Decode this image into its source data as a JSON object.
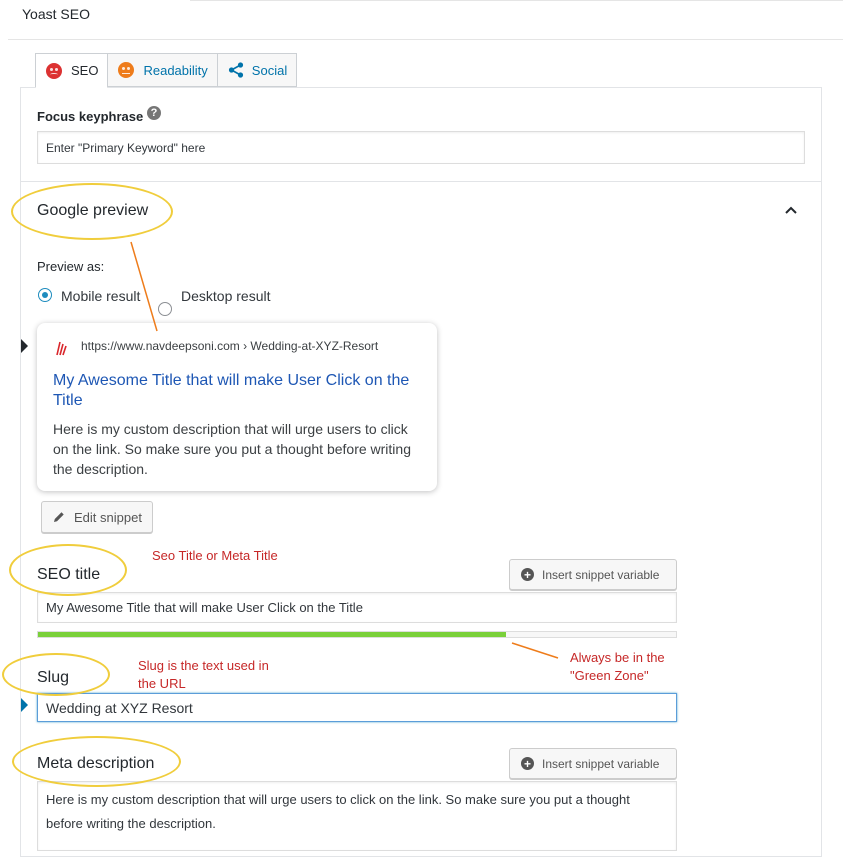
{
  "panel": {
    "title": "Yoast SEO"
  },
  "tabs": [
    {
      "label": "SEO",
      "icon": "sad-face-icon",
      "color": "#dc3232"
    },
    {
      "label": "Readability",
      "icon": "neutral-face-icon",
      "color": "#ee7c1b"
    },
    {
      "label": "Social",
      "icon": "share-icon"
    }
  ],
  "focus": {
    "label": "Focus keyphrase",
    "help": "?",
    "value": "Enter \"Primary Keyword\"  here"
  },
  "google_preview": {
    "heading": "Google preview",
    "preview_as": "Preview as:",
    "options": [
      "Mobile result",
      "Desktop result"
    ],
    "selected": "Mobile result",
    "card": {
      "url": "https://www.navdeepsoni.com › Wedding-at-XYZ-Resort",
      "title": "My Awesome Title that will make User Click on the Title",
      "description": "Here is my custom description that will urge users to click on the link. So make sure you put a thought before writing the description."
    },
    "edit_button": "Edit snippet"
  },
  "seo_title": {
    "label": "SEO title",
    "insert_button": "Insert snippet variable",
    "value": "My Awesome Title that will make User Click on the Title",
    "progress_fraction": 0.734,
    "progress_color": "#7ad03a"
  },
  "slug": {
    "label": "Slug",
    "value": "Wedding at XYZ Resort"
  },
  "meta_description": {
    "label": "Meta description",
    "insert_button": "Insert snippet variable",
    "value": "Here is my custom description that will urge users to click on the link. So make sure you put a thought before writing the description."
  },
  "annotations": {
    "seo_title_note": "Seo Title or Meta Title",
    "slug_note_line1": "Slug is the text used in",
    "slug_note_line2": "the URL",
    "green_zone_line1": "Always be in the",
    "green_zone_line2": "\"Green Zone\"",
    "highlight_color": "#f0cd3c",
    "arrow_color": "#ee7c1b",
    "note_color": "#c62828"
  }
}
